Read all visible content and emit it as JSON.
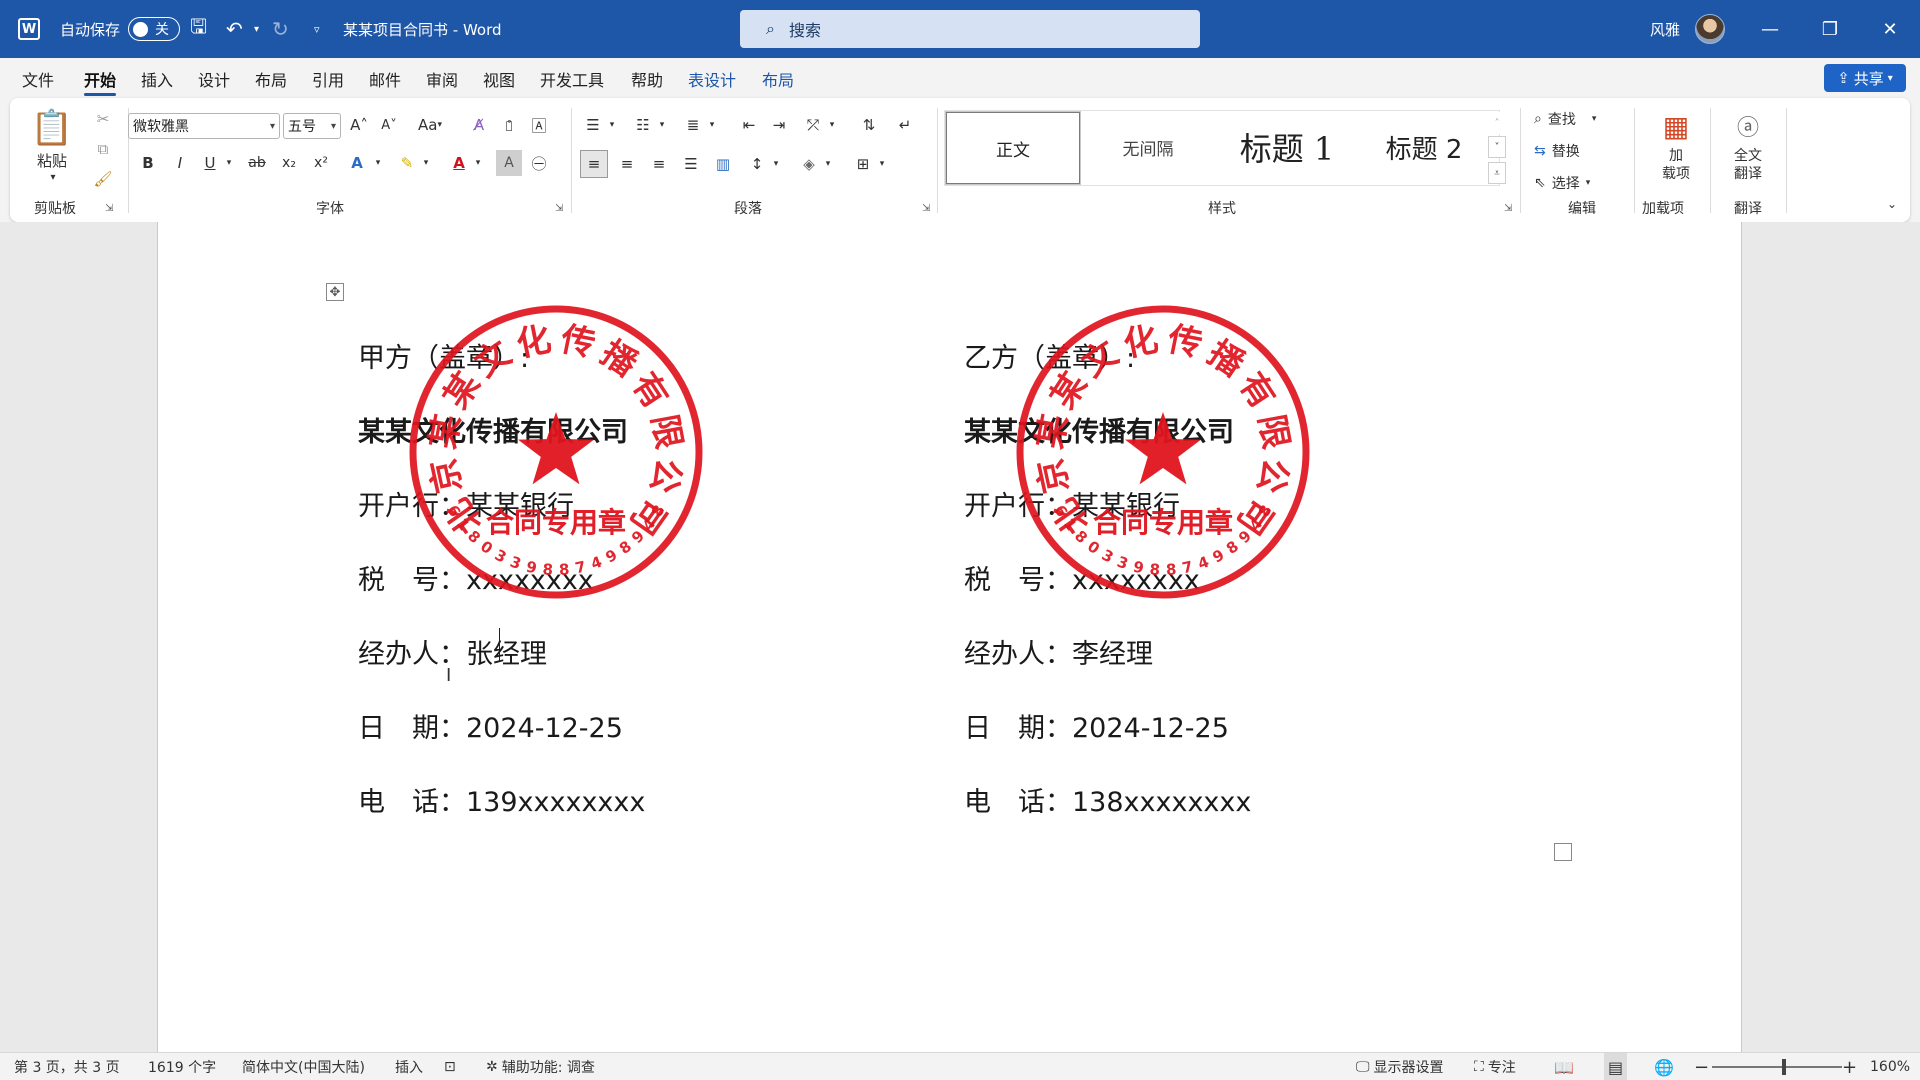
{
  "titlebar": {
    "autosave_label": "自动保存",
    "autosave_state": "关",
    "doc_title": "某某项目合同书 - Word",
    "search_placeholder": "搜索",
    "user_name": "风雅",
    "minimize": "—",
    "restore": "❐",
    "close": "✕"
  },
  "menu": {
    "items": [
      "文件",
      "开始",
      "插入",
      "设计",
      "布局",
      "引用",
      "邮件",
      "审阅",
      "视图",
      "开发工具",
      "帮助",
      "表设计",
      "布局"
    ],
    "active": "开始",
    "share": "共享"
  },
  "ribbon": {
    "clipboard": {
      "label": "剪贴板",
      "paste": "粘贴"
    },
    "font": {
      "label": "字体",
      "family": "微软雅黑",
      "size": "五号",
      "case": "Aa"
    },
    "paragraph": {
      "label": "段落"
    },
    "styles": {
      "label": "样式",
      "items": [
        "正文",
        "无间隔",
        "标题 1",
        "标题 2"
      ]
    },
    "editing": {
      "label": "编辑",
      "find": "查找",
      "replace": "替换",
      "select": "选择"
    },
    "addins": {
      "label": "加载项",
      "button_line1": "加",
      "button_line2": "载项"
    },
    "translate": {
      "label": "翻译",
      "button_line1": "全文",
      "button_line2": "翻译"
    }
  },
  "document": {
    "party_a": {
      "heading": "甲方（盖章）:",
      "company": "某某文化传播有限公司",
      "bank": "开户行：某某银行",
      "tax": "税　号：xxxxxxxx",
      "agent": "经办人：张经理",
      "date": "日　期：2024-12-25",
      "phone": "电　话：139xxxxxxxx"
    },
    "party_b": {
      "heading": "乙方（盖章）:",
      "company": "某某文化传播有限公司",
      "bank": "开户行：某某银行",
      "tax": "税　号：xxxxxxxx",
      "agent": "经办人：李经理",
      "date": "日　期：2024-12-25",
      "phone": "电　话：138xxxxxxxx"
    },
    "seal": {
      "ring_text": "北京某某文化传播有限公司",
      "inner_text": "合同专用章",
      "number": "6180339887498948",
      "color": "#e0141e"
    }
  },
  "statusbar": {
    "page": "第 3 页，共 3 页",
    "words": "1619 个字",
    "language": "简体中文(中国大陆)",
    "mode": "插入",
    "accessibility": "辅助功能: 调查",
    "display_settings": "显示器设置",
    "focus": "专注",
    "zoom": "160%"
  }
}
